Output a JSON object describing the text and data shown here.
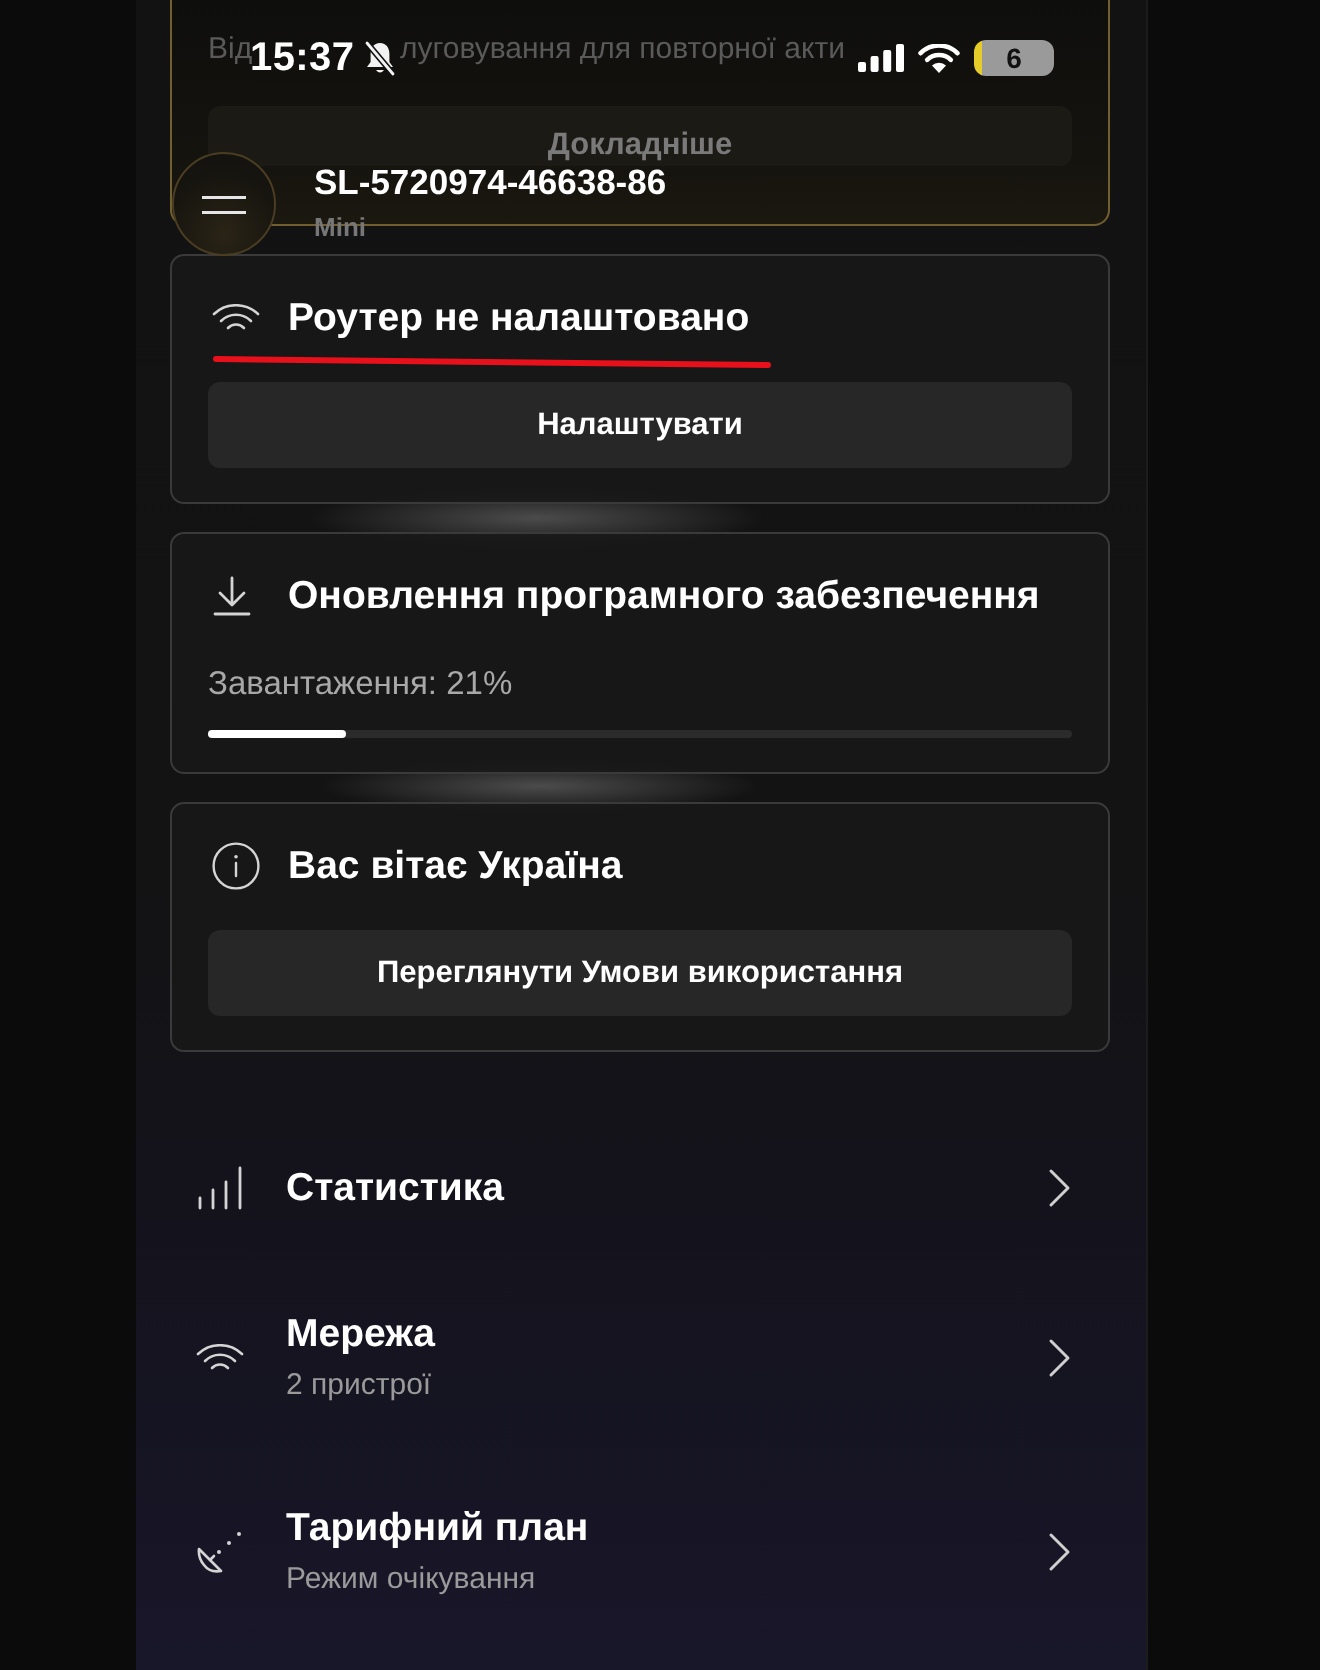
{
  "status_bar": {
    "time": "15:37",
    "silent": true,
    "battery": "6"
  },
  "notice": {
    "visible_text": [
      "Від",
      "луговування для повторної акти"
    ],
    "button": "Докладніше"
  },
  "header": {
    "device_name": "SL-5720974-46638-86",
    "model": "Mini"
  },
  "cards": [
    {
      "kind": "setup",
      "title": "Роутер не налаштовано",
      "underlined": true,
      "button": "Налаштувати"
    },
    {
      "kind": "progress",
      "title": "Оновлення програмного забезпечення",
      "underlined": false,
      "status": "Завантаження: 21%",
      "level": 0.16
    },
    {
      "kind": "welcome",
      "title": "Вас вітає Україна",
      "underlined": false,
      "button": "Переглянути Умови використання"
    }
  ],
  "menu": [
    {
      "kind": "stats",
      "title": "Статистика"
    },
    {
      "kind": "network",
      "title": "Мережа",
      "subtitle": "2 пристрої"
    },
    {
      "kind": "plan",
      "title": "Тарифний план",
      "subtitle": "Режим очікування"
    }
  ]
}
